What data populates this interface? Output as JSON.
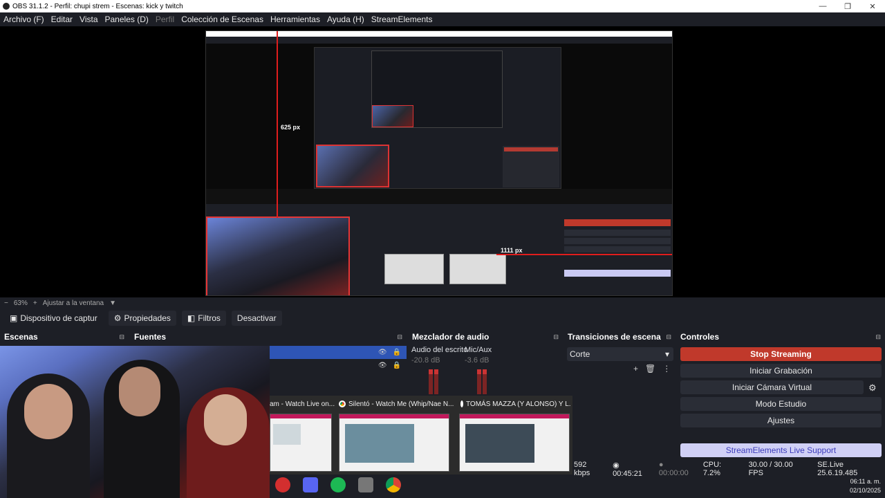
{
  "window": {
    "title": "OBS 31.1.2 - Perfil: chupi strem - Escenas: kick y twitch",
    "minimize": "—",
    "maximize": "❐",
    "close": "✕"
  },
  "menu": [
    {
      "label": "Archivo (F)"
    },
    {
      "label": "Editar"
    },
    {
      "label": "Vista"
    },
    {
      "label": "Paneles (D)"
    },
    {
      "label": "Perfil",
      "disabled": true
    },
    {
      "label": "Colección de Escenas"
    },
    {
      "label": "Herramientas"
    },
    {
      "label": "Ayuda (H)"
    },
    {
      "label": "StreamElements"
    }
  ],
  "preview": {
    "measure_v": "625 px",
    "measure_h": "1111 px"
  },
  "zoombar": {
    "minus": "−",
    "zoom": "63%",
    "plus": "+",
    "fit": "Ajustar a la ventana",
    "caret": "▼"
  },
  "sourcebar": {
    "source_name": "Dispositivo de captur",
    "properties": "Propiedades",
    "filters": "Filtros",
    "deactivate": "Desactivar"
  },
  "docks": {
    "scenes": "Escenas",
    "sources": "Fuentes",
    "mixer": "Mezclador de audio",
    "transitions": "Transiciones de escena",
    "controls": "Controles",
    "dock_icon": "⊟"
  },
  "mixer": {
    "channels": [
      {
        "name": "Audio del escrito",
        "db": "-20.8 dB"
      },
      {
        "name": "Mic/Aux",
        "db": "-3.6 dB"
      }
    ]
  },
  "transitions": {
    "selected": "Corte",
    "add": "+",
    "delete": "🗑",
    "more": "⋮"
  },
  "controls": {
    "stop_streaming": "Stop Streaming",
    "start_recording": "Iniciar Grabación",
    "virtual_camera": "Iniciar Cámara Virtual",
    "studio_mode": "Modo Estudio",
    "settings": "Ajustes",
    "se_support": "StreamElements Live Support"
  },
  "task_thumbnails": [
    {
      "title": "am - Watch Live on..."
    },
    {
      "title": "Silentó - Watch Me (Whip/Nae N..."
    },
    {
      "title": "TOMÁS MAZZA (Y ALONSO) Y L..."
    }
  ],
  "status": {
    "bitrate": "592 kbps",
    "stream_time": "00:45:21",
    "rec_time": "00:00:00",
    "cpu": "CPU: 7.2%",
    "fps": "30.00 / 30.00 FPS",
    "version": "SE.Live 25.6.19.485"
  },
  "clock": {
    "time": "06:11 a. m.",
    "date": "02/10/2025"
  },
  "colors": {
    "accent_red": "#c0392b",
    "selection_blue": "#2e55b5",
    "se_support_bg": "#d0d0f5"
  }
}
